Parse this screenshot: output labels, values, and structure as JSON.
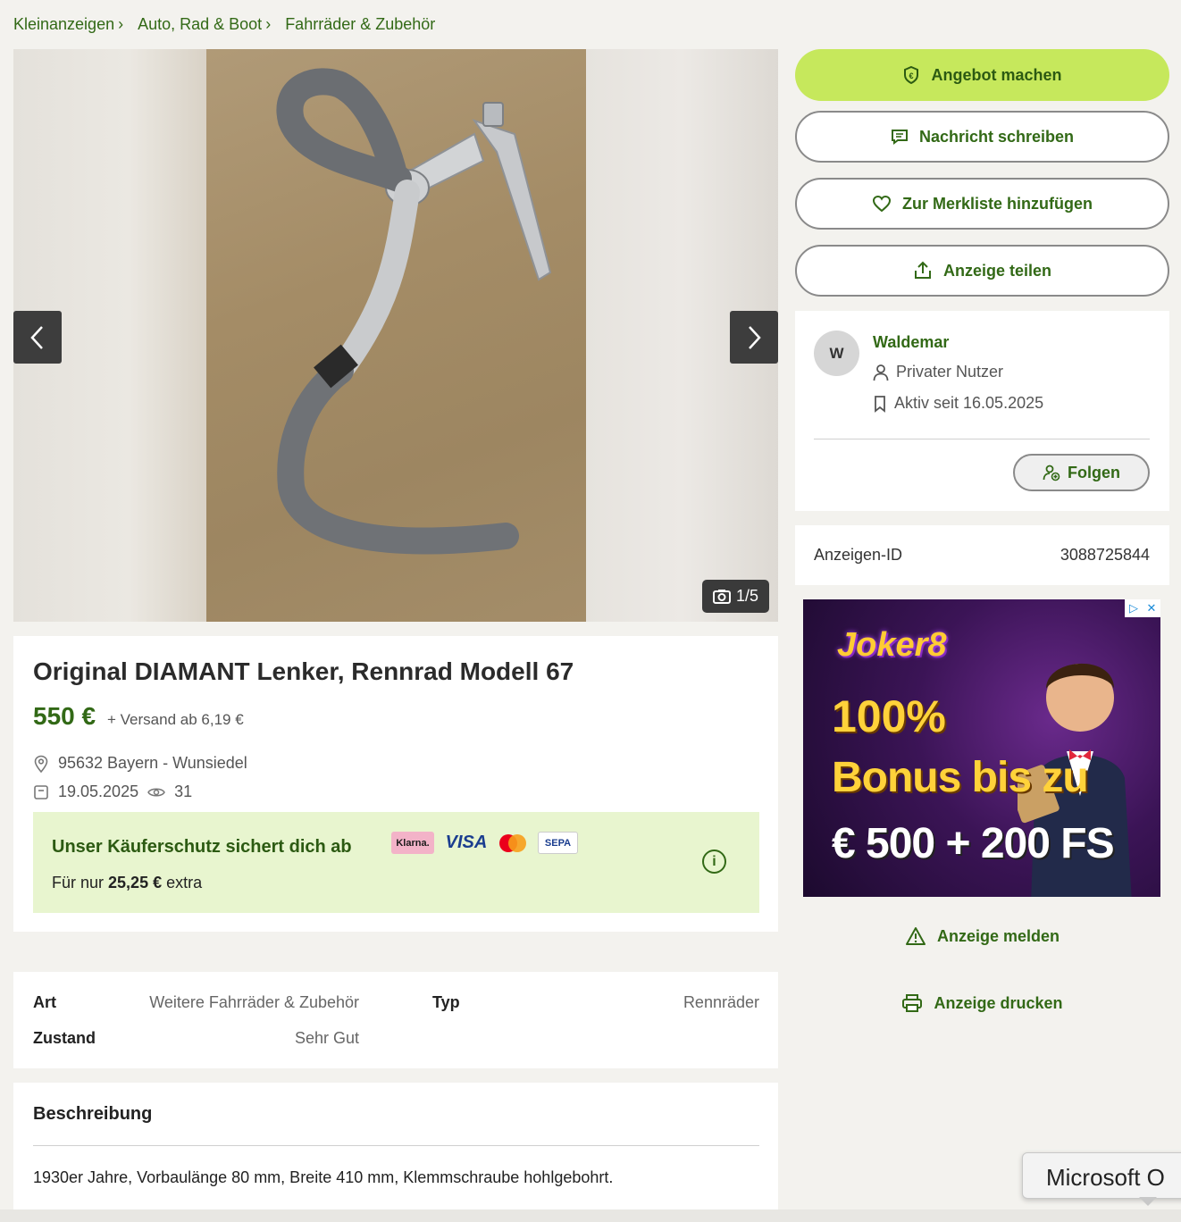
{
  "breadcrumb": [
    "Kleinanzeigen",
    "Auto, Rad & Boot",
    "Fahrräder & Zubehör"
  ],
  "gallery": {
    "counter": "1/5"
  },
  "actions": {
    "offer": "Angebot machen",
    "message": "Nachricht schreiben",
    "watchlist": "Zur Merkliste hinzufügen",
    "share": "Anzeige teilen"
  },
  "seller": {
    "initial": "W",
    "name": "Waldemar",
    "type": "Privater Nutzer",
    "since": "Aktiv seit 16.05.2025",
    "follow": "Folgen"
  },
  "ad_id": {
    "label": "Anzeigen-ID",
    "value": "3088725844"
  },
  "banner": {
    "brand": "Joker8",
    "line1": "100%",
    "line2": "Bonus bis zu",
    "line3": "€ 500 + 200 FS"
  },
  "side_links": {
    "report": "Anzeige melden",
    "print": "Anzeige drucken"
  },
  "listing": {
    "title": "Original DIAMANT Lenker, Rennrad Modell 67",
    "price": "550 €",
    "shipping": "+ Versand ab 6,19 €",
    "location": "95632 Bayern - Wunsiedel",
    "date": "19.05.2025",
    "views": "31"
  },
  "buyer_protection": {
    "title": "Unser Käuferschutz sichert dich ab",
    "prefix": "Für nur ",
    "amount": "25,25 €",
    "suffix": " extra",
    "payments": [
      "Klarna.",
      "VISA",
      "SEPA"
    ]
  },
  "attributes": {
    "art_label": "Art",
    "art_value": "Weitere Fahrräder & Zubehör",
    "typ_label": "Typ",
    "typ_value": "Rennräder",
    "zustand_label": "Zustand",
    "zustand_value": "Sehr Gut"
  },
  "description": {
    "title": "Beschreibung",
    "text": "1930er Jahre, Vorbaulänge 80 mm, Breite 410 mm, Klemmschraube hohlgebohrt."
  },
  "tooltip": "Microsoft O",
  "colors": {
    "brand_green": "#326916",
    "accent_lime": "#c6e85c",
    "buyer_bg": "#e8f5cf"
  }
}
